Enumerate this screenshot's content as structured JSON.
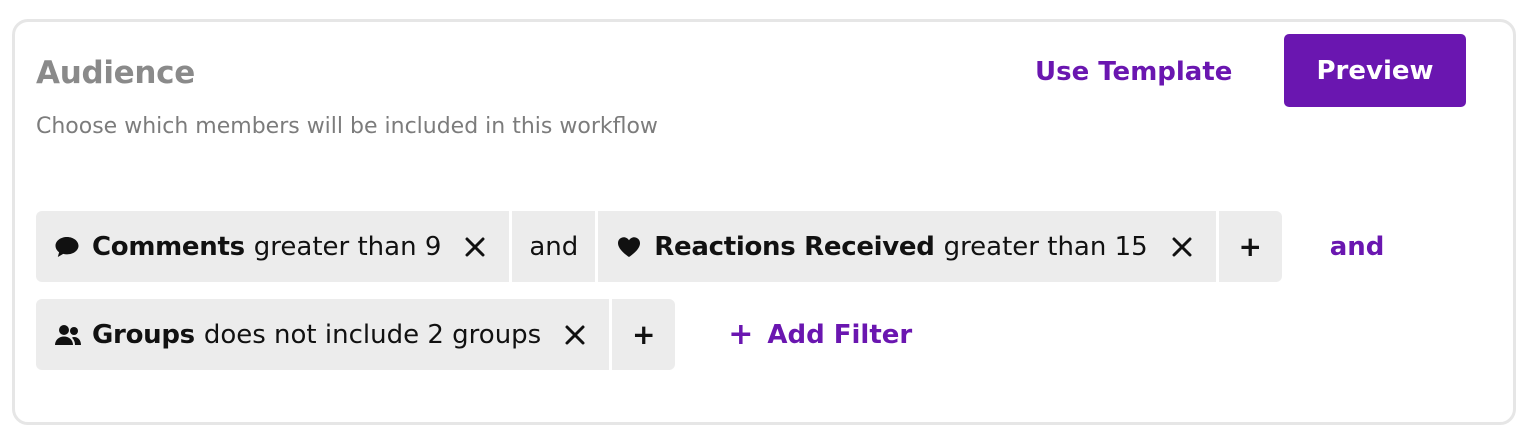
{
  "header": {
    "title": "Audience",
    "subtitle": "Choose which members will be included in this workflow",
    "use_template_label": "Use Template",
    "preview_label": "Preview"
  },
  "filters": {
    "row1": {
      "chip1": {
        "icon": "comment-icon",
        "field": "Comments",
        "condition": "greater than 9"
      },
      "joiner": "and",
      "chip2": {
        "icon": "heart-icon",
        "field": "Reactions Received",
        "condition": "greater than 15"
      },
      "plus": "+",
      "group_joiner": "and"
    },
    "row2": {
      "chip1": {
        "icon": "users-icon",
        "field": "Groups",
        "condition": "does not include 2 groups"
      },
      "plus": "+",
      "add_filter_label": "Add Filter",
      "add_filter_plus": "+"
    }
  },
  "colors": {
    "accent": "#6a16b0",
    "chip_bg": "#ececec",
    "title_gray": "#8a8a8a",
    "border": "#e6e6e6"
  }
}
